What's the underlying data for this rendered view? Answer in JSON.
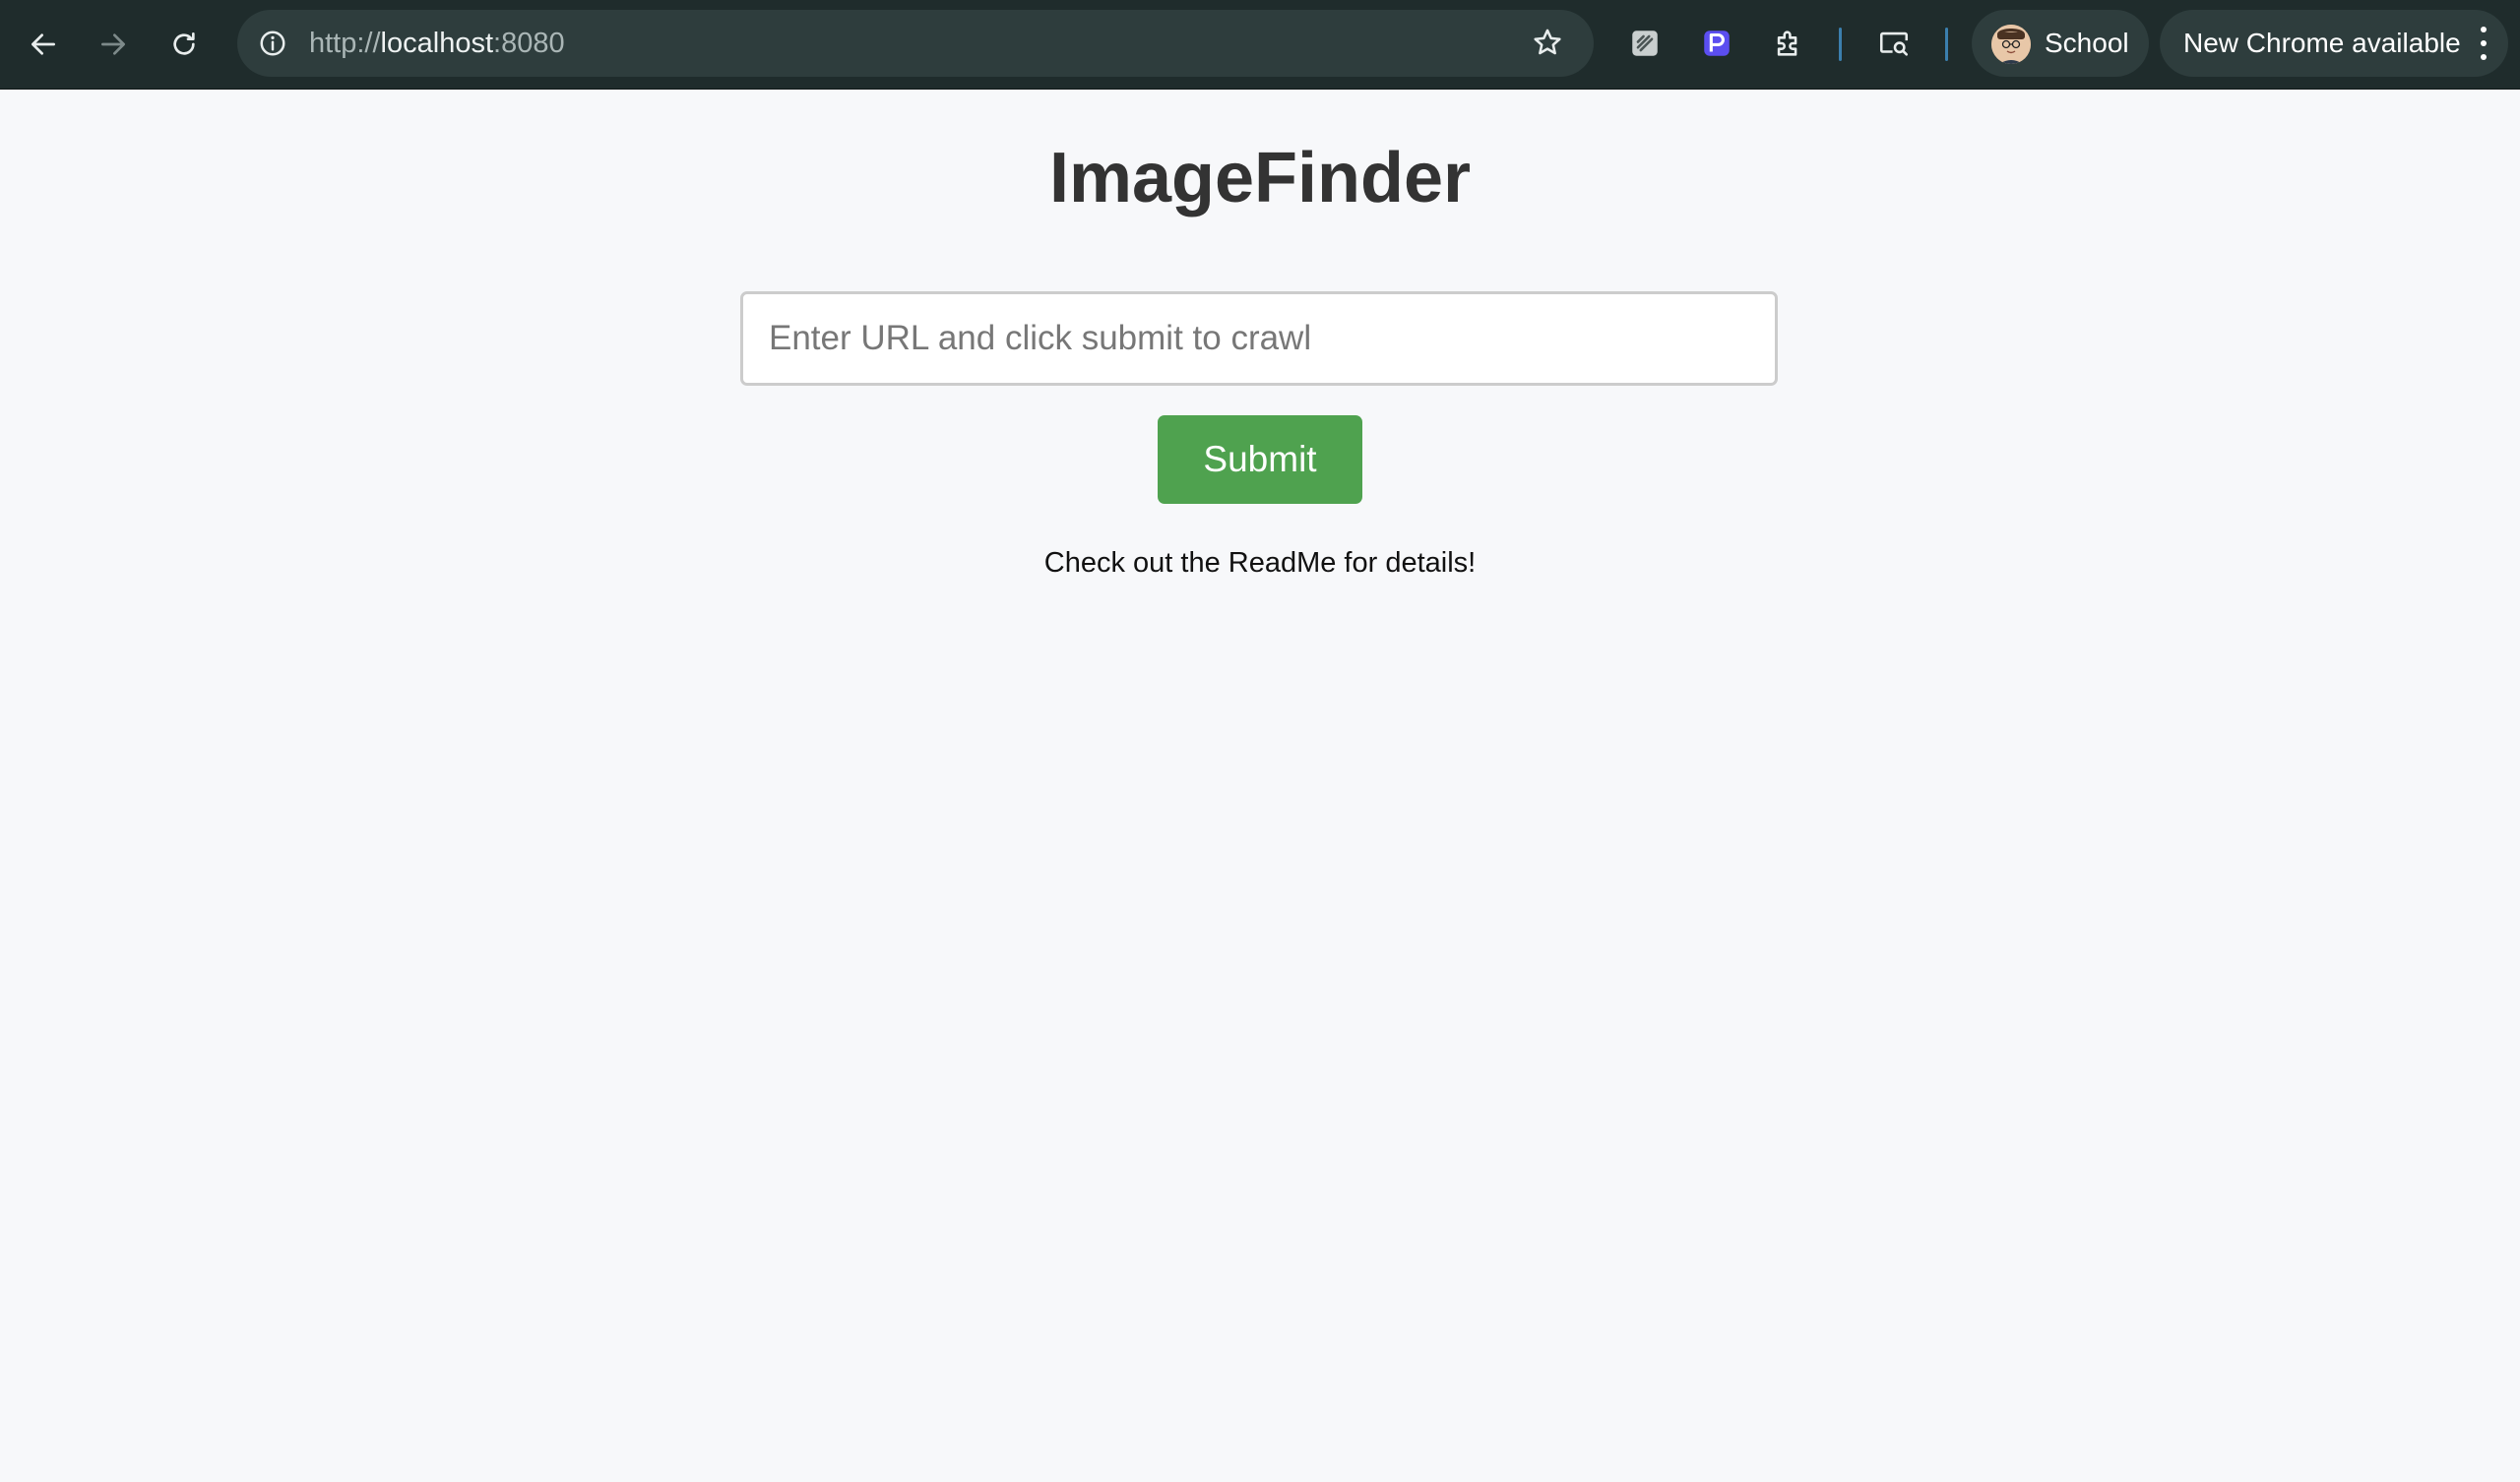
{
  "browser": {
    "url_scheme": "http://",
    "url_host": "localhost",
    "url_port": ":8080",
    "profile_name": "School",
    "update_label": "New Chrome available",
    "icons": {
      "back": "arrow-left-icon",
      "forward": "arrow-right-icon",
      "reload": "reload-icon",
      "site_info": "info-icon",
      "bookmark": "star-icon",
      "extension_1": "pen-extension-icon",
      "extension_2": "purple-extension-icon",
      "extensions_menu": "puzzle-icon",
      "tab_search": "tab-search-icon",
      "menu": "kebab-icon"
    },
    "colors": {
      "toolbar": "#1f2c2c",
      "omnibox": "#2e3d3d",
      "separator": "#3b7fae"
    }
  },
  "page": {
    "title": "ImageFinder",
    "input_placeholder": "Enter URL and click submit to crawl",
    "input_value": "",
    "submit_label": "Submit",
    "note": "Check out the ReadMe for details!",
    "colors": {
      "background": "#f7f8fa",
      "button": "#4fa24f",
      "title": "#333333"
    }
  }
}
